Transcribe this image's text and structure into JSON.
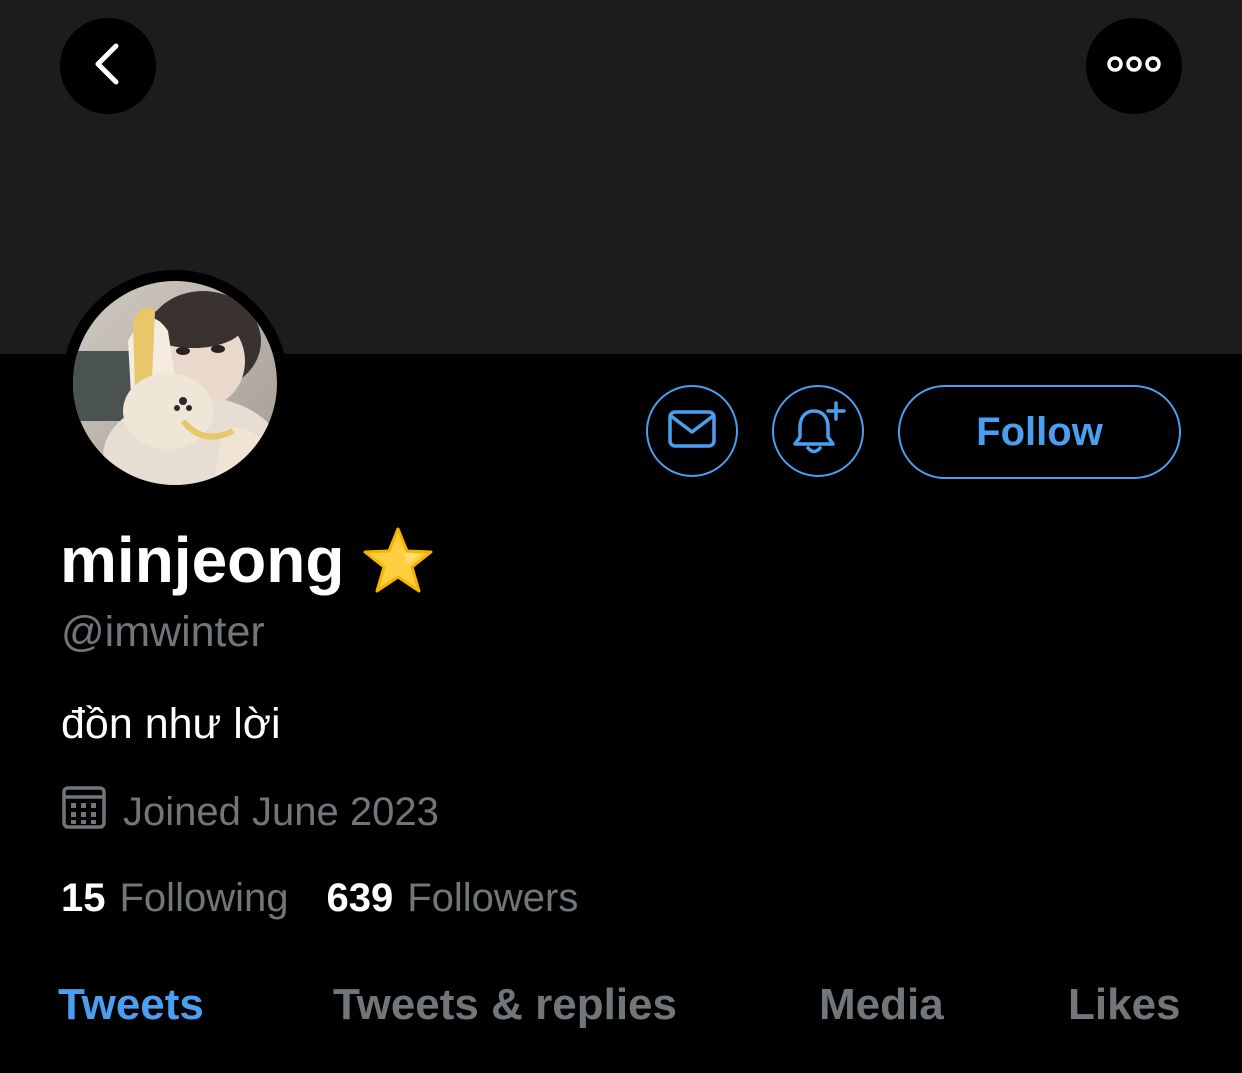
{
  "profile": {
    "display_name": "minjeong",
    "handle": "@imwinter",
    "bio": "đồn như lời",
    "joined": "Joined June 2023"
  },
  "stats": {
    "following_count": "15",
    "following_label": "Following",
    "followers_count": "639",
    "followers_label": "Followers"
  },
  "actions": {
    "follow_label": "Follow"
  },
  "tabs": [
    {
      "label": "Tweets",
      "active": true
    },
    {
      "label": "Tweets & replies",
      "active": false
    },
    {
      "label": "Media",
      "active": false
    },
    {
      "label": "Likes",
      "active": false
    }
  ],
  "icons": {
    "back": "chevron-left-icon",
    "more": "more-dots-icon",
    "message": "envelope-icon",
    "notifications": "bell-plus-icon",
    "verified_emoji": "star-icon",
    "calendar": "calendar-icon"
  },
  "colors": {
    "accent": "#4a9ff0",
    "background": "#000000",
    "banner": "#1c1c1e",
    "muted_text": "#71767b",
    "primary_text": "#ffffff"
  }
}
